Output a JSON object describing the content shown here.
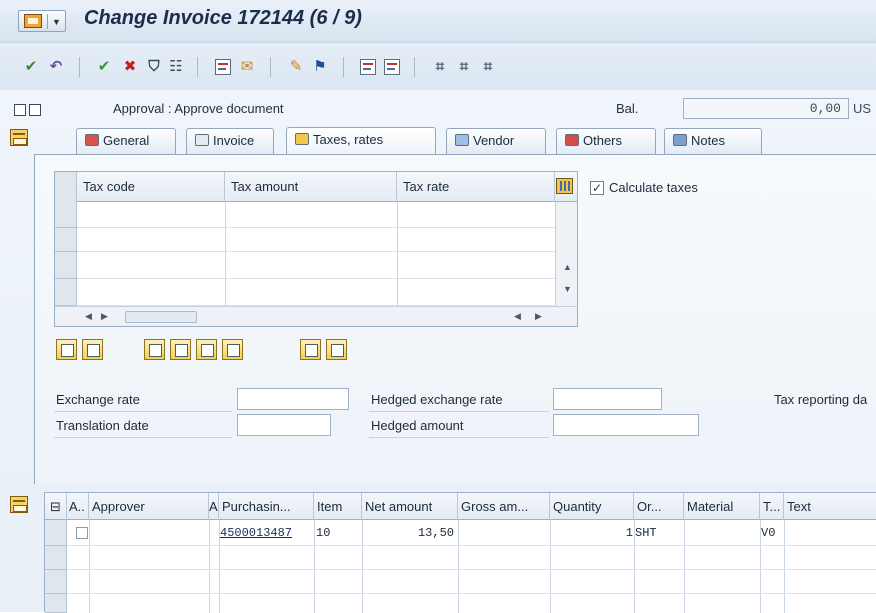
{
  "window": {
    "title": "Change Invoice 172144 (6 / 9)"
  },
  "toolbar": {
    "buttons": [
      "confirm-all",
      "undo",
      "accept",
      "reject",
      "filter",
      "details",
      "document",
      "mail",
      "edit",
      "flag",
      "save",
      "print",
      "network-1",
      "network-2",
      "network-3"
    ]
  },
  "header": {
    "status": "Approval : Approve document",
    "balance_label": "Bal.",
    "balance_value": "0,00",
    "balance_currency": "US"
  },
  "tabs": [
    {
      "label": "General",
      "icon": "printer-icon"
    },
    {
      "label": "Invoice",
      "icon": "document-icon"
    },
    {
      "label": "Taxes, rates",
      "icon": "percent-icon",
      "active": true
    },
    {
      "label": "Vendor",
      "icon": "vendor-icon"
    },
    {
      "label": "Others",
      "icon": "list-icon"
    },
    {
      "label": "Notes",
      "icon": "notes-icon"
    }
  ],
  "tax_table": {
    "columns": [
      "Tax code",
      "Tax amount",
      "Tax rate"
    ],
    "rows": [
      [
        "",
        "",
        ""
      ],
      [
        "",
        "",
        ""
      ],
      [
        "",
        "",
        ""
      ],
      [
        "",
        "",
        ""
      ]
    ]
  },
  "calculate_taxes": {
    "label": "Calculate taxes",
    "checked": true,
    "mark": "✓"
  },
  "exchange": {
    "exchange_rate_label": "Exchange rate",
    "exchange_rate_value": "",
    "translation_date_label": "Translation date",
    "translation_date_value": "",
    "hedged_rate_label": "Hedged exchange rate",
    "hedged_rate_value": "",
    "hedged_amount_label": "Hedged amount",
    "hedged_amount_value": "",
    "tax_reporting_label": "Tax reporting da"
  },
  "approval_table": {
    "columns": [
      "A..",
      "Approver",
      "A",
      "Purchasin...",
      "Item",
      "Net amount",
      "Gross am...",
      "Quantity",
      "Or...",
      "Material",
      "T...",
      "Text"
    ],
    "rows": [
      {
        "selected": false,
        "approver": "",
        "a": "",
        "po": "4500013487",
        "item": "10",
        "net_amount": "13,50",
        "gross_amount": "",
        "quantity": "1",
        "unit": "SHT",
        "material": "",
        "tax": "V0",
        "text": ""
      }
    ]
  },
  "colors": {
    "accent": "#f0a437",
    "header_bg": "#dbe6f1",
    "panel_bg": "#eef3f9",
    "check": "#1b3f6b"
  }
}
